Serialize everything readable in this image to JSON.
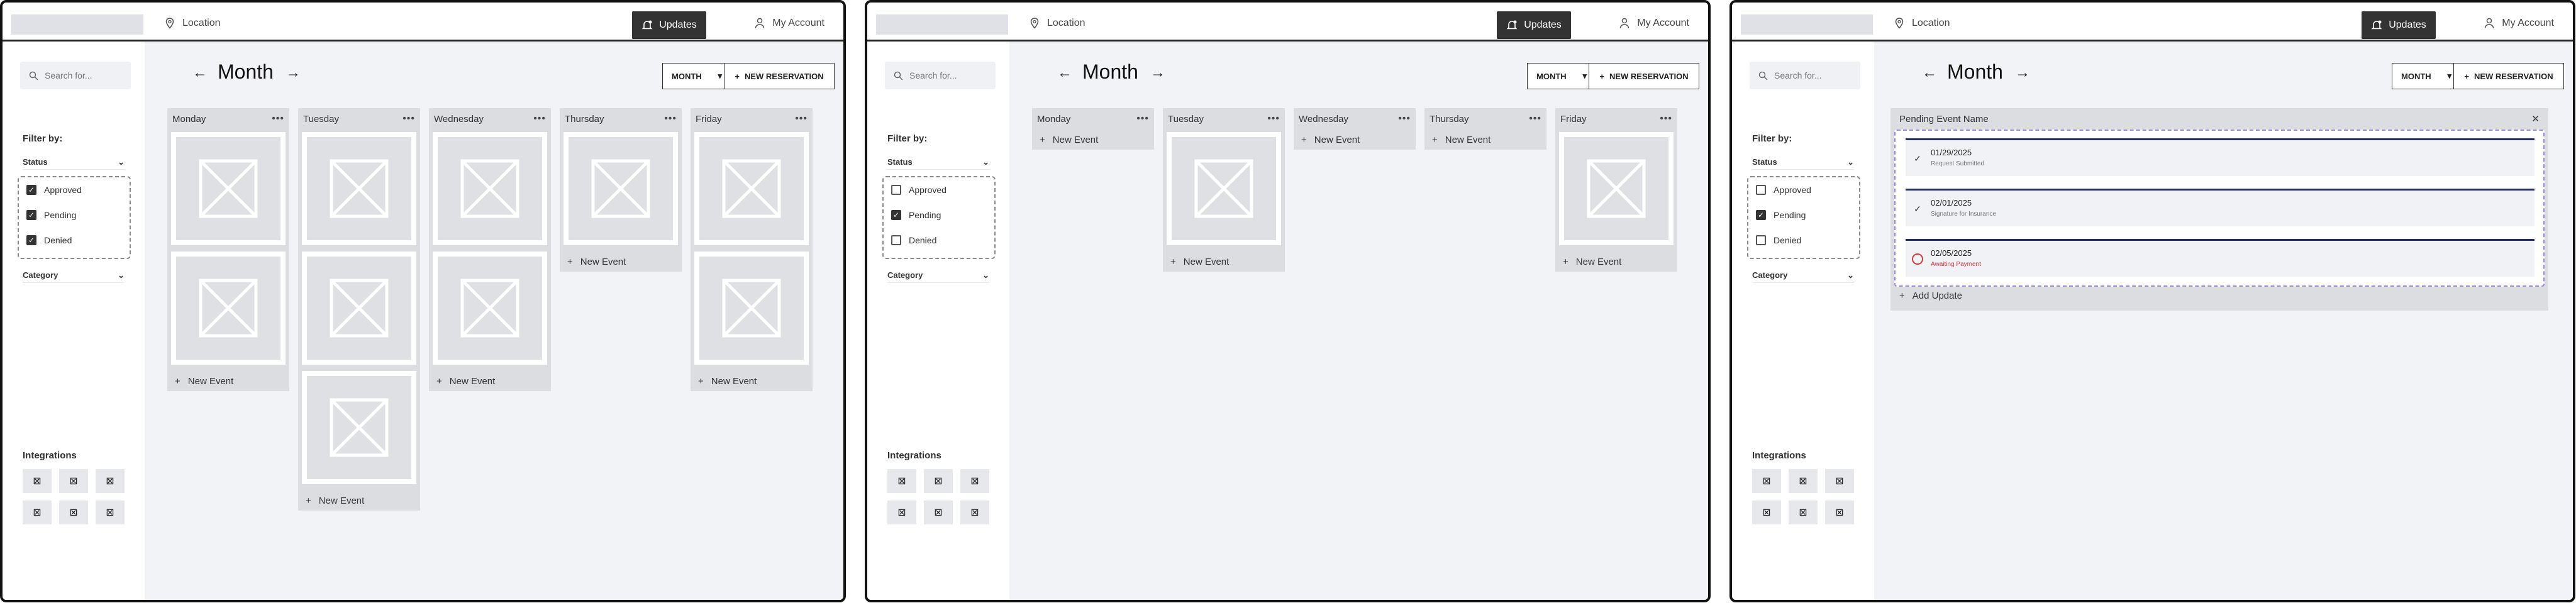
{
  "header": {
    "location": "Location",
    "updates_label": "Updates",
    "account_label": "My Account"
  },
  "sidebar": {
    "search_placeholder": "Search for...",
    "filter_title": "Filter by:",
    "status_label": "Status",
    "options": [
      "Approved",
      "Pending",
      "Denied"
    ],
    "category_label": "Category",
    "integrations_title": "Integrations"
  },
  "main": {
    "title": "Month",
    "view_select": "MONTH",
    "new_reservation": "NEW RESERVATION",
    "days": [
      "Monday",
      "Tuesday",
      "Wednesday",
      "Thursday",
      "Friday"
    ],
    "new_event": "New Event"
  },
  "screens": [
    {
      "checked": [
        true,
        true,
        true
      ],
      "cards": [
        2,
        3,
        2,
        1,
        2
      ]
    },
    {
      "checked": [
        false,
        true,
        false
      ],
      "cards": [
        0,
        1,
        0,
        0,
        1
      ]
    },
    {
      "checked": [
        false,
        true,
        false
      ]
    }
  ],
  "panel": {
    "title": "Pending Event Name",
    "updates": [
      {
        "date": "01/29/2025",
        "desc": "Request Submitted",
        "status": "done"
      },
      {
        "date": "02/01/2025",
        "desc": "Signature for Insurance",
        "status": "done"
      },
      {
        "date": "02/05/2025",
        "desc": "Awaiting Payment",
        "status": "pending"
      }
    ],
    "add_update": "Add Update"
  },
  "colors": {
    "accent_dark": "#333333",
    "update_rule": "#1f2d5c",
    "error": "#d23b3b",
    "selection_dash": "#9a87e0"
  }
}
